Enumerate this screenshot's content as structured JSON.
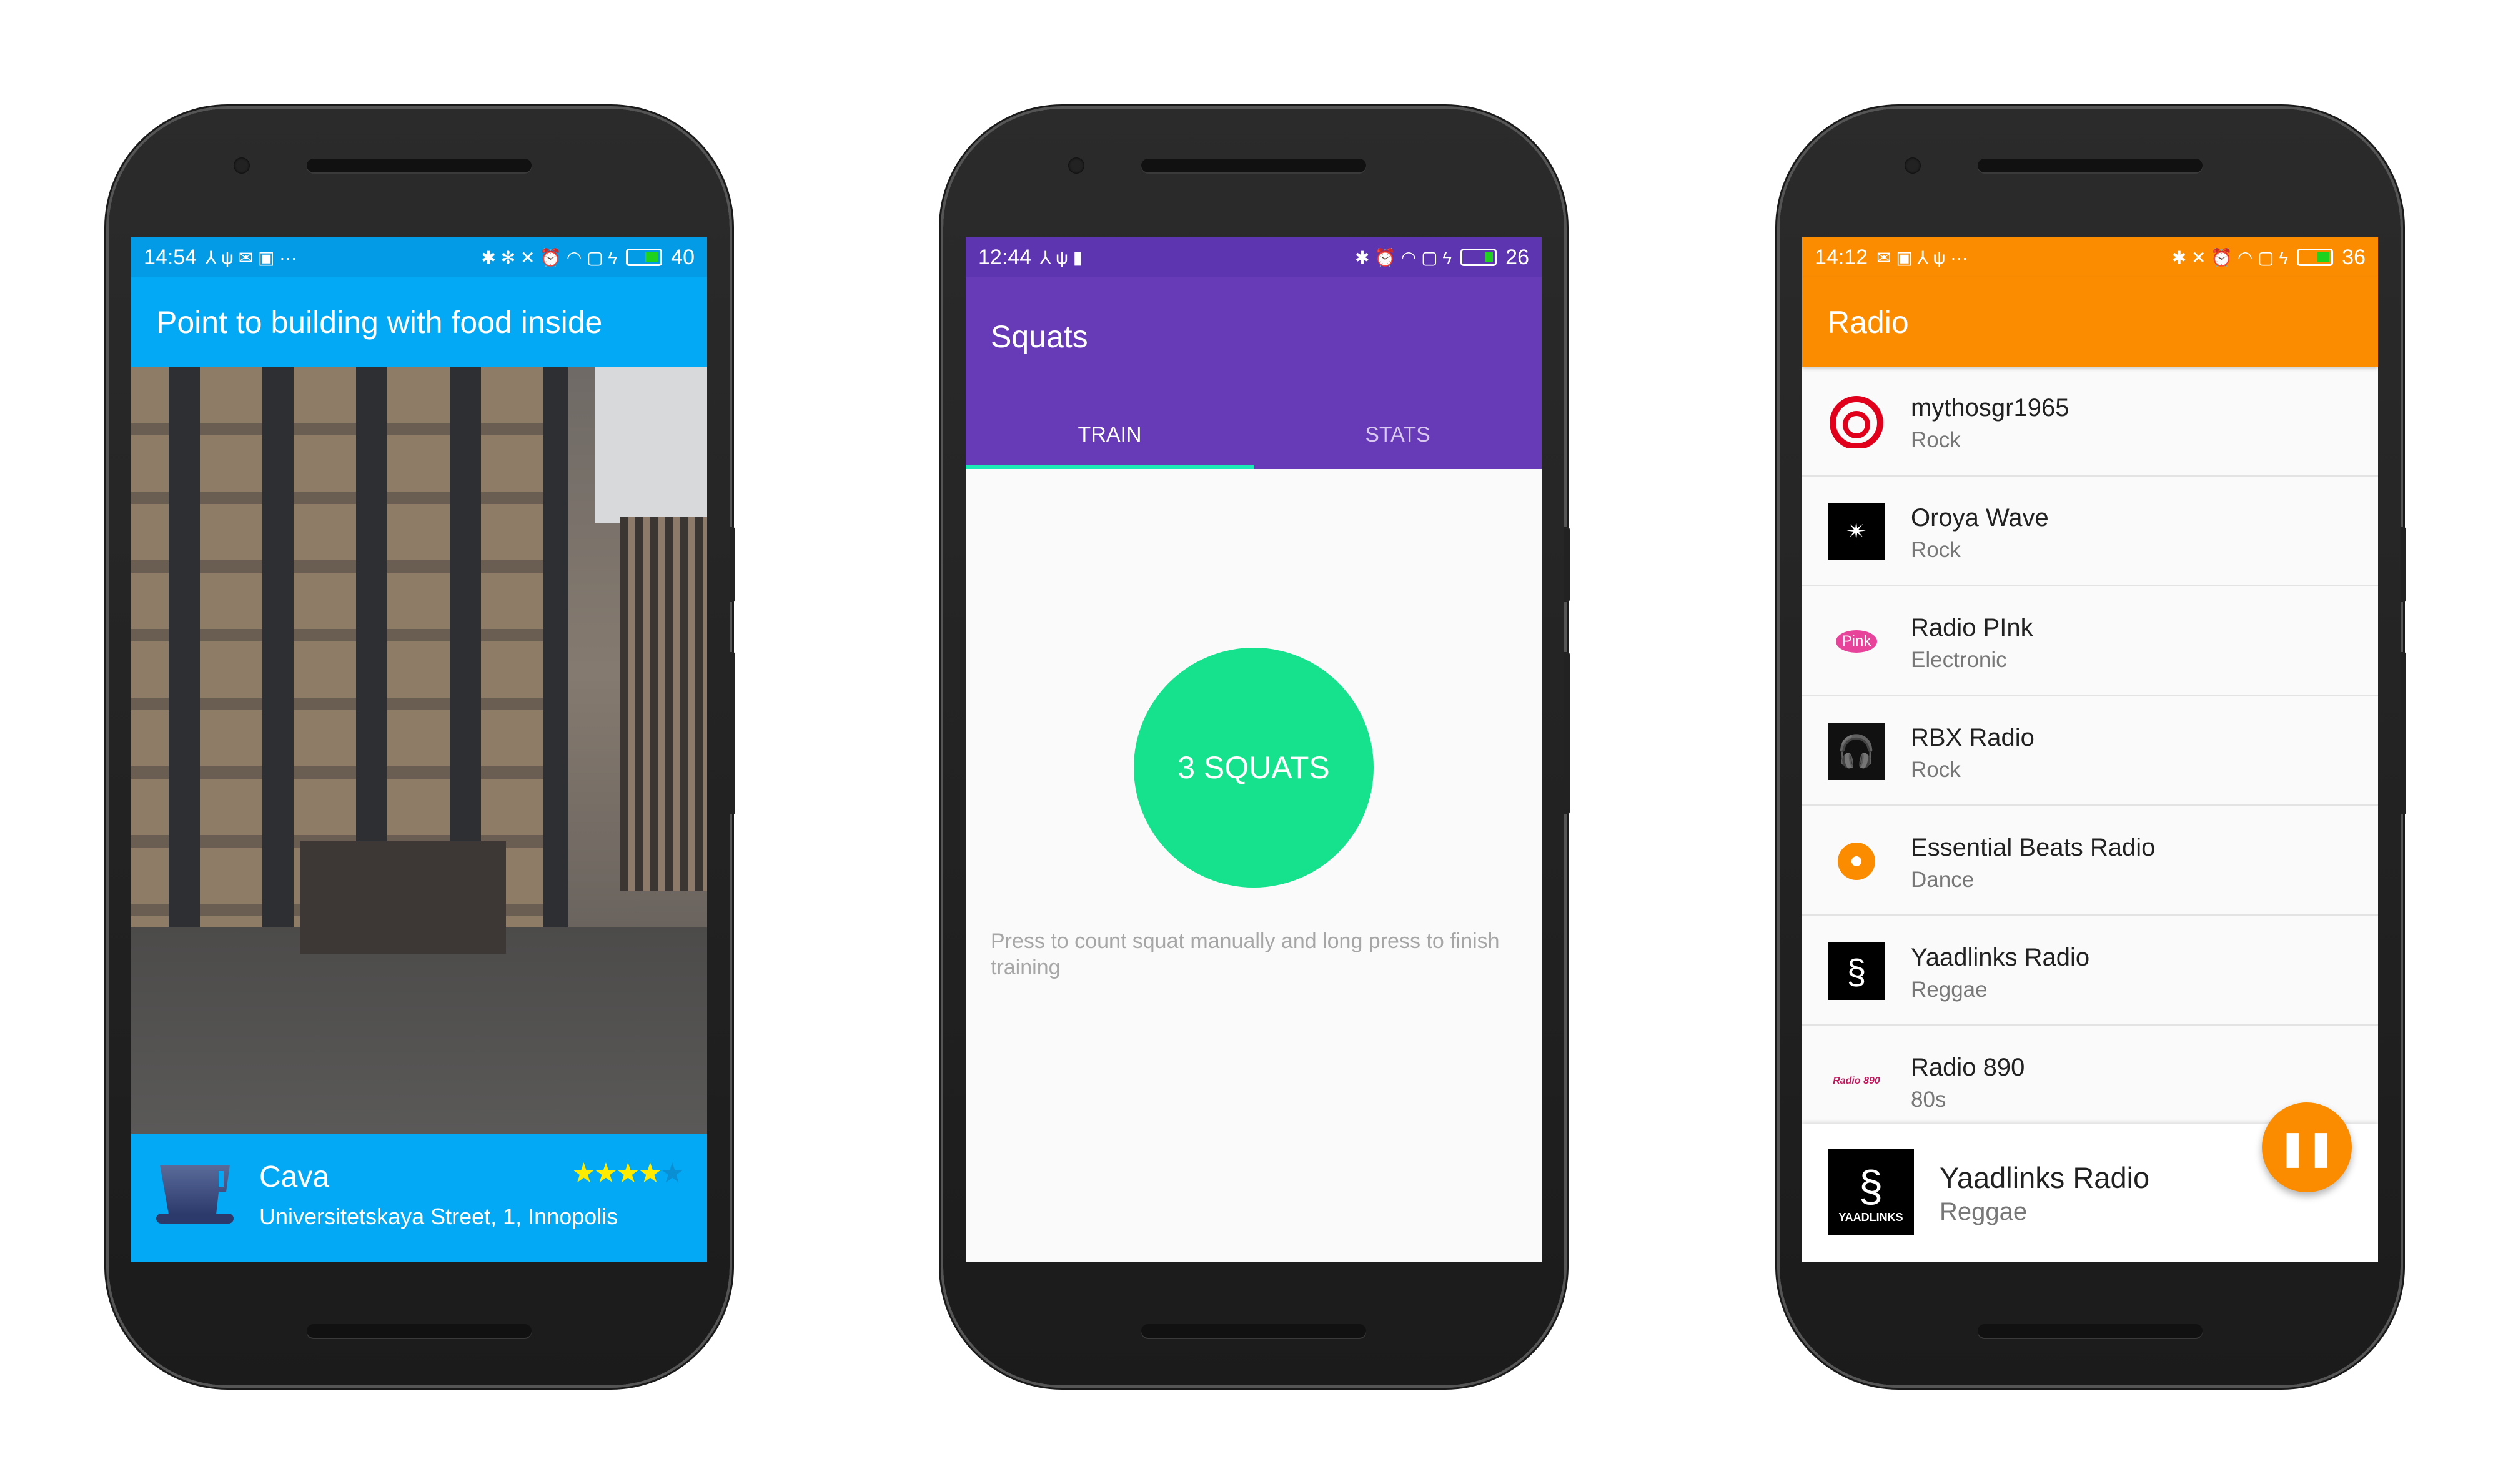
{
  "phones": [
    {
      "status": {
        "time": "14:54",
        "battery": "40"
      },
      "title": "Point to building with food inside",
      "place": {
        "name": "Cava",
        "address": "Universitetskaya Street, 1, Innopolis",
        "rating": 4,
        "max_rating": 5
      },
      "colors": {
        "status": "#039be5",
        "primary": "#03a9f4"
      }
    },
    {
      "status": {
        "time": "12:44",
        "battery": "26"
      },
      "title": "Squats",
      "tabs": [
        {
          "label": "TRAIN",
          "active": true
        },
        {
          "label": "STATS",
          "active": false
        }
      ],
      "counter_button": "3 SQUATS",
      "hint": "Press to count squat manually and long press to finish training",
      "colors": {
        "status": "#5e35b1",
        "primary": "#673ab7",
        "accent": "#16e28d"
      }
    },
    {
      "status": {
        "time": "14:12",
        "battery": "36"
      },
      "title": "Radio",
      "stations": [
        {
          "name": "mythosgr1965",
          "genre": "Rock"
        },
        {
          "name": "Oroya Wave",
          "genre": "Rock"
        },
        {
          "name": "Radio PInk",
          "genre": "Electronic"
        },
        {
          "name": "RBX Radio",
          "genre": "Rock"
        },
        {
          "name": "Essential Beats Radio",
          "genre": "Dance"
        },
        {
          "name": "Yaadlinks Radio",
          "genre": "Reggae"
        },
        {
          "name": "Radio 890",
          "genre": "80s"
        }
      ],
      "now_playing": {
        "name": "Yaadlinks Radio",
        "genre": "Reggae",
        "logo_text": "YAADLINKS"
      },
      "logos": {
        "pink": "Pink",
        "r890": "Radio 890"
      },
      "fab_icon": "pause-icon",
      "colors": {
        "status": "#fb8c00",
        "primary": "#fb8c00"
      }
    }
  ]
}
